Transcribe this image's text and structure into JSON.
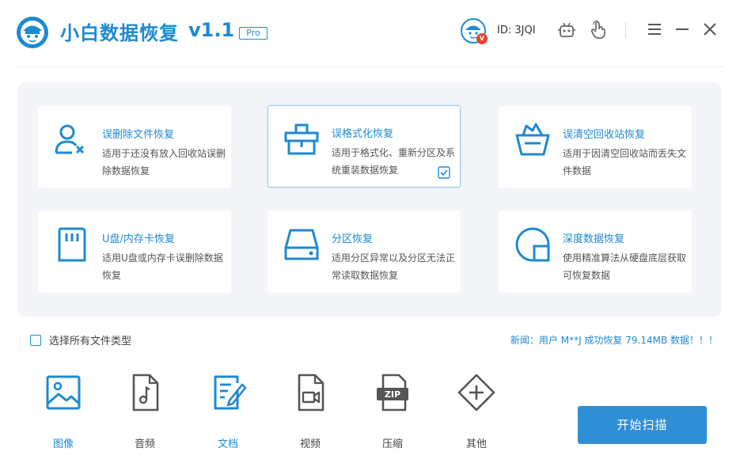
{
  "app": {
    "title": "小白数据恢复",
    "version": "v1.1",
    "badge": "Pro"
  },
  "user": {
    "vip": "V",
    "id_text": "ID: 3JQI"
  },
  "categories": [
    {
      "title": "误删除文件恢复",
      "desc": "适用于还没有放入回收站误删除数据恢复",
      "icon": "user-delete-icon",
      "selected": false
    },
    {
      "title": "误格式化恢复",
      "desc": "适用于格式化、重新分区及系统重装数据恢复",
      "icon": "format-drive-icon",
      "selected": true
    },
    {
      "title": "误清空回收站恢复",
      "desc": "适用于因清空回收站而丢失文件数据",
      "icon": "recycle-bin-icon",
      "selected": false
    },
    {
      "title": "U盘/内存卡恢复",
      "desc": "适用U盘或内存卡误删除数据恢复",
      "icon": "sd-card-icon",
      "selected": false
    },
    {
      "title": "分区恢复",
      "desc": "适用分区异常以及分区无法正常读取数据恢复",
      "icon": "hard-drive-icon",
      "selected": false
    },
    {
      "title": "深度数据恢复",
      "desc": "使用精准算法从硬盘底层获取可恢复数据",
      "icon": "deep-scan-icon",
      "selected": false
    }
  ],
  "select_all": {
    "label": "选择所有文件类型",
    "checked": false
  },
  "news": "新闻：用户 M**J 成功恢复 79.14MB 数据！！！",
  "file_types": [
    {
      "label": "图像",
      "icon": "image-icon",
      "active": true
    },
    {
      "label": "音频",
      "icon": "audio-icon",
      "active": false
    },
    {
      "label": "文档",
      "icon": "document-icon",
      "active": true
    },
    {
      "label": "视频",
      "icon": "video-icon",
      "active": false
    },
    {
      "label": "压缩",
      "icon": "zip-icon",
      "active": false
    },
    {
      "label": "其他",
      "icon": "other-icon",
      "active": false
    }
  ],
  "scan_button": "开始扫描",
  "colors": {
    "accent": "#1e8ad2",
    "button": "#2f8fd6",
    "vip": "#e8432f",
    "panel": "#f3f5f8"
  }
}
